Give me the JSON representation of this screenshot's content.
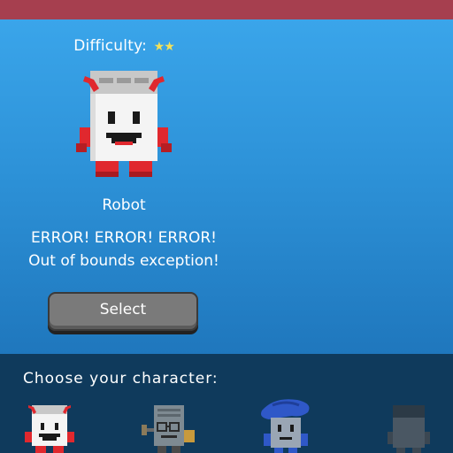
{
  "difficulty": {
    "label": "Difficulty:",
    "stars": "★★",
    "rating": 2
  },
  "selected_character": {
    "name": "Robot",
    "description_line1": "ERROR! ERROR! ERROR!",
    "description_line2": "Out of bounds exception!"
  },
  "select_button": {
    "label": "Select"
  },
  "character_picker": {
    "label": "Choose your character:",
    "characters": [
      {
        "id": "robot",
        "icon": "robot-icon",
        "selected": true
      },
      {
        "id": "engineer",
        "icon": "engineer-icon",
        "selected": false
      },
      {
        "id": "wizard",
        "icon": "wizard-icon",
        "selected": false
      },
      {
        "id": "locked",
        "icon": "locked-character-icon",
        "selected": false
      }
    ]
  },
  "colors": {
    "top_bar": "#a63f4f",
    "main_panel": "#2d92d8",
    "bottom_panel": "#0f3a5c",
    "star": "#f2e15a",
    "robot_accent": "#e0282e"
  }
}
